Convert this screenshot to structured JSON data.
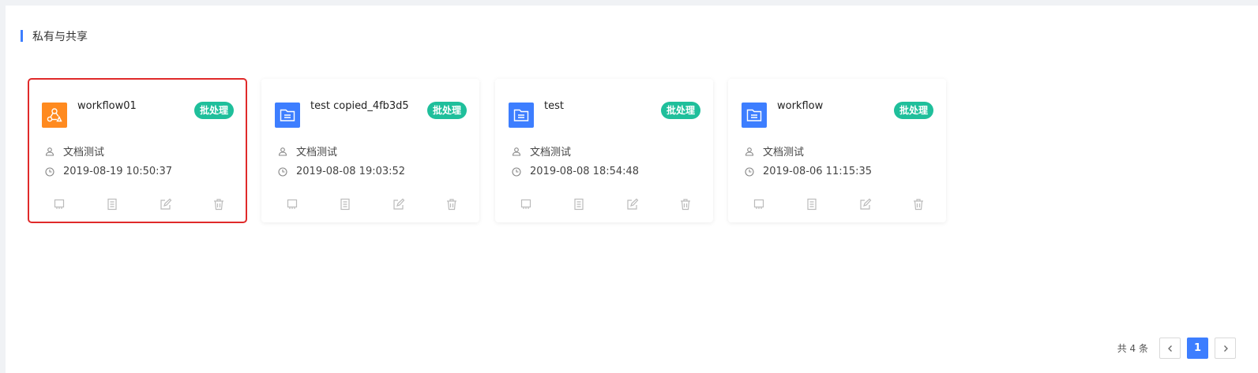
{
  "section": {
    "title": "私有与共享"
  },
  "cards": [
    {
      "name": "workflow01",
      "badge": "批处理",
      "owner": "文档测试",
      "time": "2019-08-19 10:50:37",
      "icon": "workflow-icon",
      "icon_color": "#ff8a1f",
      "selected": true
    },
    {
      "name": "test copied_4fb3d5",
      "badge": "批处理",
      "owner": "文档测试",
      "time": "2019-08-08 19:03:52",
      "icon": "folder-icon",
      "icon_color": "#3d7eff",
      "selected": false
    },
    {
      "name": "test",
      "badge": "批处理",
      "owner": "文档测试",
      "time": "2019-08-08 18:54:48",
      "icon": "folder-icon",
      "icon_color": "#3d7eff",
      "selected": false
    },
    {
      "name": "workflow",
      "badge": "批处理",
      "owner": "文档测试",
      "time": "2019-08-06 11:15:35",
      "icon": "folder-icon",
      "icon_color": "#3d7eff",
      "selected": false
    }
  ],
  "pagination": {
    "total_label": "共 4 条",
    "current_page": "1"
  },
  "colors": {
    "accent": "#3d7eff",
    "badge": "#1fbf9b",
    "selected_outline": "#e02a2a"
  }
}
